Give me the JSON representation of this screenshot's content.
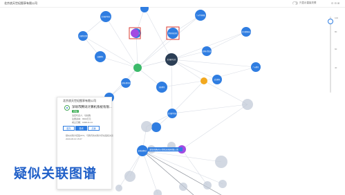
{
  "header": {
    "company_title": "北京浪天世纪图享有限公司",
    "toggle_label": "只显示直接关联",
    "icons": "⊡ ⊟ ⊞"
  },
  "zoom": {
    "ticks": [
      "100",
      "80",
      "60",
      "40"
    ],
    "level": 1.0
  },
  "card": {
    "header": "北京浪天世纪图享有限公司",
    "company_name": "深圳市腾讯计算机系统有限...",
    "badge": "存续",
    "lines": [
      "法定代表人：马化腾",
      "注册资本：6500万元",
      "成立日期：1998-11-11"
    ],
    "buttons": [
      "股东",
      "投资",
      "高管"
    ],
    "notes": [
      "疑似关联方控股20%，与腾讯的关联方存在股权关系",
      "2020-08-10 15:07"
    ]
  },
  "overlay_label": "疑似关联图谱",
  "colors": {
    "blue": "#2f7de1",
    "purple": "#a24be2",
    "green": "#3cba6a",
    "dark": "#2b3e55",
    "orange": "#f2a81e",
    "grey": "#bfc8d6",
    "highlight": "#d9372f"
  },
  "graph_nodes": [
    {
      "label": "",
      "c": "blue"
    },
    {
      "label": "北京图享科技",
      "c": "blue"
    },
    {
      "label": "广州华多网络",
      "c": "blue"
    },
    {
      "label": "北京腾讯文化传媒",
      "c": "blue"
    },
    {
      "label": "深圳市腾讯计算机",
      "c": "blue"
    },
    {
      "label": "上海腾讯企鹅影视",
      "c": "blue"
    },
    {
      "label": "",
      "c": "purple"
    },
    {
      "label": "腾讯科技深圳",
      "c": "blue"
    },
    {
      "label": "北京搜狗科技",
      "c": "blue"
    },
    {
      "label": "成都腾讯",
      "c": "blue"
    },
    {
      "label": "深圳市世纪凯旋",
      "c": "blue"
    },
    {
      "label": "",
      "c": "green"
    },
    {
      "label": "北京图享文化传播有限公司",
      "c": "dark"
    },
    {
      "label": "广州腾讯",
      "c": "blue"
    },
    {
      "label": "深圳市腾讯网络",
      "c": "blue"
    },
    {
      "label": "海南腾讯",
      "c": "blue"
    },
    {
      "label": "武汉腾讯",
      "c": "blue"
    },
    {
      "label": "",
      "c": "orange"
    },
    {
      "label": "",
      "c": "blue"
    },
    {
      "label": "北京图享传媒",
      "c": "blue"
    },
    {
      "label": "",
      "c": "grey"
    },
    {
      "label": "",
      "c": "blue"
    },
    {
      "label": "",
      "c": "grey"
    },
    {
      "label": "",
      "c": "grey"
    },
    {
      "label": "",
      "c": "grey"
    },
    {
      "label": "深圳市腾讯计算机",
      "c": "blue"
    },
    {
      "label": "",
      "c": "purple"
    },
    {
      "label": "",
      "c": "grey"
    },
    {
      "label": "",
      "c": "grey"
    },
    {
      "label": "",
      "c": "grey"
    },
    {
      "label": "",
      "c": "grey"
    },
    {
      "label": "",
      "c": "grey"
    },
    {
      "label": "",
      "c": "grey"
    },
    {
      "label": "",
      "c": "grey"
    }
  ],
  "edge_label": "深圳市腾讯计算机系统有限公司",
  "highlighted_nodes": [
    6,
    7
  ]
}
